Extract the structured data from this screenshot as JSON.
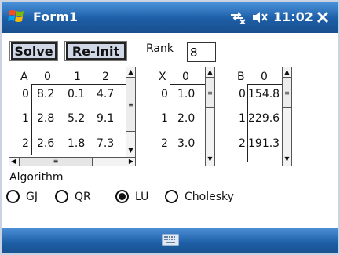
{
  "window": {
    "title": "Form1",
    "time": "11:02"
  },
  "buttons": {
    "solve": "Solve",
    "reinit": "Re-Init"
  },
  "rank": {
    "label": "Rank",
    "value": "8"
  },
  "matrixA": {
    "header": [
      "A",
      "0",
      "1",
      "2"
    ],
    "rows": [
      {
        "index": "0",
        "values": [
          "8.2",
          "0.1",
          "4.7"
        ]
      },
      {
        "index": "1",
        "values": [
          "2.8",
          "5.2",
          "9.1"
        ]
      },
      {
        "index": "2",
        "values": [
          "2.6",
          "1.8",
          "7.3"
        ]
      }
    ]
  },
  "matrixX": {
    "header": [
      "X",
      "0"
    ],
    "rows": [
      {
        "index": "0",
        "value": "1.0"
      },
      {
        "index": "1",
        "value": "2.0"
      },
      {
        "index": "2",
        "value": "3.0"
      }
    ]
  },
  "matrixB": {
    "header": [
      "B",
      "0"
    ],
    "rows": [
      {
        "index": "0",
        "value": "154.8"
      },
      {
        "index": "1",
        "value": "229.6"
      },
      {
        "index": "2",
        "value": "191.3"
      }
    ]
  },
  "algorithm": {
    "label": "Algorithm",
    "options": [
      "GJ",
      "QR",
      "LU",
      "Cholesky"
    ],
    "selected": "LU"
  },
  "icons": [
    "windows-logo-icon",
    "connectivity-icon",
    "volume-muted-icon",
    "close-icon",
    "keyboard-icon"
  ]
}
